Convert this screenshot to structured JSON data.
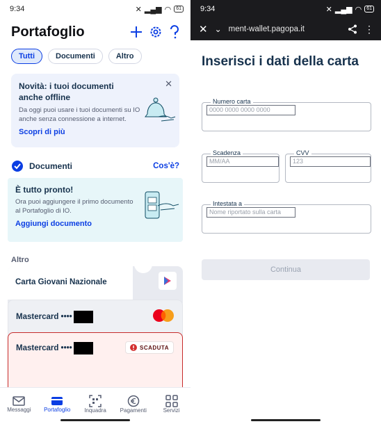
{
  "left": {
    "status": {
      "time": "9:34",
      "battery": "61"
    },
    "title": "Portafoglio",
    "chips": [
      "Tutti",
      "Documenti",
      "Altro"
    ],
    "banner": {
      "title": "Novità: i tuoi documenti anche offline",
      "body": "Da oggi puoi usare i tuoi documenti su IO anche senza connessione a internet.",
      "link": "Scopri di più"
    },
    "documents": {
      "label": "Documenti",
      "link": "Cos'è?"
    },
    "ready": {
      "title": "È tutto pronto!",
      "body": "Ora puoi aggiungere il primo documento al Portafoglio di IO.",
      "link": "Aggiungi documento"
    },
    "other_label": "Altro",
    "cards": {
      "youth": "Carta Giovani Nazionale",
      "mc1": "Mastercard ••••",
      "mc2": "Mastercard ••••",
      "expired": "SCADUTA"
    },
    "tabs": [
      "Messaggi",
      "Portafoglio",
      "Inquadra",
      "Pagamenti",
      "Servizi"
    ]
  },
  "right": {
    "status": {
      "time": "9:34",
      "battery": "61"
    },
    "url": "ment-wallet.pagopa.it",
    "title": "Inserisci i dati della carta",
    "fields": {
      "number": {
        "label": "Numero carta",
        "placeholder": "0000 0000 0000 0000"
      },
      "expiry": {
        "label": "Scadenza",
        "placeholder": "MM/AA"
      },
      "cvv": {
        "label": "CVV",
        "placeholder": "123"
      },
      "holder": {
        "label": "Intestata a",
        "placeholder": "Nome riportato sulla carta"
      }
    },
    "continue": "Continua"
  }
}
